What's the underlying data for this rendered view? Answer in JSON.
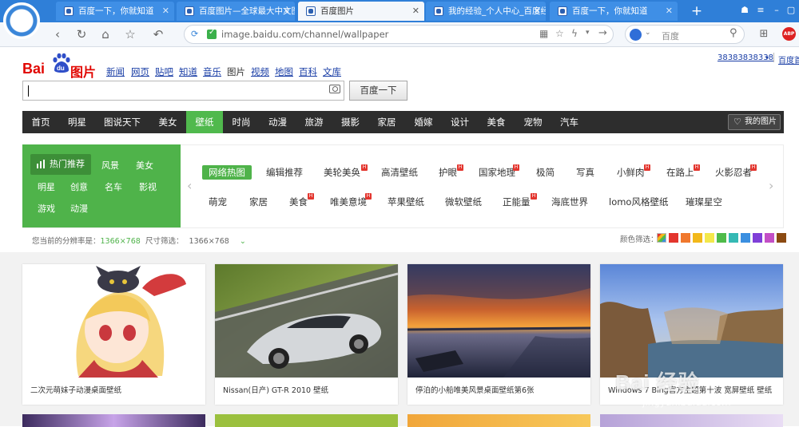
{
  "browser": {
    "tabs": [
      {
        "label": "百度一下，你就知道",
        "active": false
      },
      {
        "label": "百度图片—全球最大中文图",
        "active": false
      },
      {
        "label": "百度图片",
        "active": true
      },
      {
        "label": "我的经验_个人中心_百度经",
        "active": false
      },
      {
        "label": "百度一下，你就知道",
        "active": false
      }
    ],
    "new_tab": "+",
    "url": "image.baidu.com/channel/wallpaper",
    "search_placeholder": "百度",
    "colors": {
      "tabbar": "#2f7fd8",
      "toolbar": "#f4f7fb"
    }
  },
  "header": {
    "logo_text": "Bai",
    "logo_du": "du",
    "logo_pic": "图片",
    "nav": [
      "新闻",
      "网页",
      "贴吧",
      "知道",
      "音乐",
      "图片",
      "视频",
      "地图",
      "百科",
      "文库"
    ],
    "current_nav": "图片",
    "search_value": "",
    "search_button": "百度一下",
    "user": "38383838338",
    "home_link": "百度首"
  },
  "categories": {
    "items": [
      "首页",
      "明星",
      "图说天下",
      "美女",
      "壁纸",
      "时尚",
      "动漫",
      "旅游",
      "摄影",
      "家居",
      "婚嫁",
      "设计",
      "美食",
      "宠物",
      "汽车"
    ],
    "active": "壁纸",
    "my_pics": "我的图片"
  },
  "filter": {
    "green_box": {
      "hot": "热门推荐",
      "items": [
        "风景",
        "美女",
        "明星",
        "创意",
        "名车",
        "影视",
        "游戏",
        "动漫"
      ]
    },
    "tags_row1": [
      {
        "label": "网络热图",
        "selected": true,
        "hot": false
      },
      {
        "label": "编辑推荐",
        "selected": false,
        "hot": false
      },
      {
        "label": "美轮美奂",
        "selected": false,
        "hot": true
      },
      {
        "label": "高清壁纸",
        "selected": false,
        "hot": false
      },
      {
        "label": "护眼",
        "selected": false,
        "hot": true
      },
      {
        "label": "国家地理",
        "selected": false,
        "hot": true
      },
      {
        "label": "极简",
        "selected": false,
        "hot": false
      },
      {
        "label": "写真",
        "selected": false,
        "hot": false
      },
      {
        "label": "小鲜肉",
        "selected": false,
        "hot": true
      },
      {
        "label": "在路上",
        "selected": false,
        "hot": true
      },
      {
        "label": "火影忍者",
        "selected": false,
        "hot": true
      }
    ],
    "tags_row2": [
      {
        "label": "萌宠",
        "hot": false
      },
      {
        "label": "家居",
        "hot": false
      },
      {
        "label": "美食",
        "hot": true
      },
      {
        "label": "唯美意境",
        "hot": true
      },
      {
        "label": "苹果壁纸",
        "hot": false
      },
      {
        "label": "微软壁纸",
        "hot": false
      },
      {
        "label": "正能量",
        "hot": true
      },
      {
        "label": "海底世界",
        "hot": false
      },
      {
        "label": "lomo风格壁纸",
        "hot": false
      },
      {
        "label": "璀璨星空",
        "hot": false
      }
    ],
    "resolution_label": "您当前的分辨率是：",
    "resolution_value": "1366×768",
    "size_label": "尺寸筛选：",
    "size_value": "1366×768",
    "color_label": "颜色筛选：",
    "swatches": [
      "#ffffff",
      "#e3352e",
      "#f0782d",
      "#f2b81a",
      "#f3e84b",
      "#4fbb4a",
      "#35b9b4",
      "#3b8fe0",
      "#7f3fd8",
      "#c34fc6",
      "#8b4a12"
    ]
  },
  "gallery": {
    "captions": [
      "二次元萌妹子动漫桌面壁纸",
      "Nissan(日产) GT-R 2010 壁纸",
      "停泊的小船唯美风景桌面壁纸第6张",
      "Windows 7 Bing官方主题第十波 宽屏壁纸 壁纸"
    ]
  },
  "watermark": {
    "text": "Bai 经验",
    "url": "jingyan.baidu.com"
  }
}
